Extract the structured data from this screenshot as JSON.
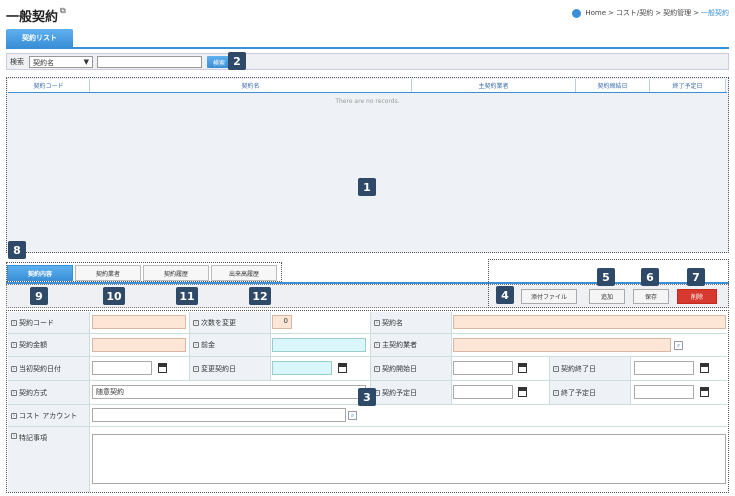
{
  "page": {
    "title": "一般契約",
    "ext_icon": "external-link-icon"
  },
  "breadcrumb": {
    "home": "Home",
    "sep1": ">",
    "item1": "コスト/契約",
    "sep2": ">",
    "item2": "契約管理",
    "sep3": ">",
    "current": "一般契約"
  },
  "main_tab": {
    "label": "契約リスト"
  },
  "search": {
    "label": "検索",
    "select_value": "契約名",
    "select_arrow": "▼",
    "input_value": "",
    "button": "検索"
  },
  "grid": {
    "columns": [
      "契約コード",
      "契約名",
      "主契約業者",
      "契約締結日",
      "終了予定日"
    ],
    "empty_text": "There are no records."
  },
  "sub_tabs": [
    "契約内容",
    "契約業者",
    "契約履歴",
    "出来高履歴"
  ],
  "actions": {
    "attach": "添付ファイル",
    "add": "追加",
    "save": "保存",
    "delete": "削除"
  },
  "badges": {
    "b1": "1",
    "b2": "2",
    "b3": "3",
    "b4": "4",
    "b5": "5",
    "b6": "6",
    "b7": "7",
    "b8": "8",
    "b9": "9",
    "b10": "10",
    "b11": "11",
    "b12": "12"
  },
  "form": {
    "contract_code": "契約コード",
    "change_count": "次数を変更",
    "change_count_value": "0",
    "contract_name": "契約名",
    "amount": "契約金額",
    "advance": "前金",
    "main_contractor": "主契約業者",
    "initial_date": "当初契約日付",
    "change_date": "変更契約日",
    "start_date": "契約開始日",
    "end_date": "契約終了日",
    "method": "契約方式",
    "method_value": "随意契約",
    "planned_date": "契約予定日",
    "planned_end": "終了予定日",
    "cost_account": "コスト アカウント",
    "remarks": "特記事項"
  }
}
